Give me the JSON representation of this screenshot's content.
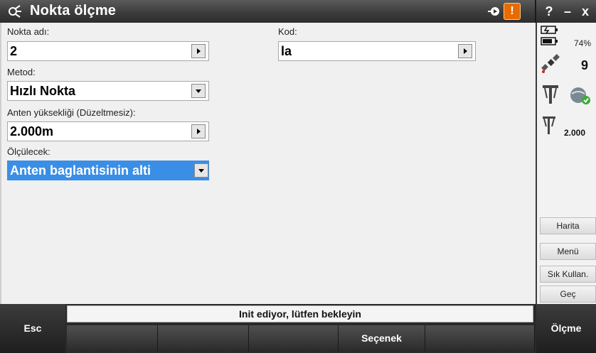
{
  "title": "Nokta ölçme",
  "titlebar": {
    "help": "?",
    "minimize": "–",
    "close": "x",
    "warning": "!"
  },
  "form": {
    "point_name_label": "Nokta adı:",
    "point_name_value": "2",
    "code_label": "Kod:",
    "code_value": "la",
    "method_label": "Metod:",
    "method_value": "Hızlı Nokta",
    "antenna_height_label": "Anten yüksekliği (Düzeltmesiz):",
    "antenna_height_value": "2.000m",
    "measured_to_label": "Ölçülecek:",
    "measured_to_value": "Anten baglantisinin alti"
  },
  "status_panel": {
    "battery_percent": "74%",
    "satellite_count": "9",
    "antenna_height": "2.000",
    "buttons": [
      "Harita",
      "Menü",
      "Sık Kullan.",
      "Geç"
    ]
  },
  "bottom": {
    "esc": "Esc",
    "status_message": "Init ediyor, lütfen bekleyin",
    "softkeys": [
      "",
      "",
      "",
      "Seçenek",
      ""
    ],
    "measure": "Ölçme"
  },
  "colors": {
    "selection": "#3a8ee6",
    "warning": "#e66b00"
  }
}
